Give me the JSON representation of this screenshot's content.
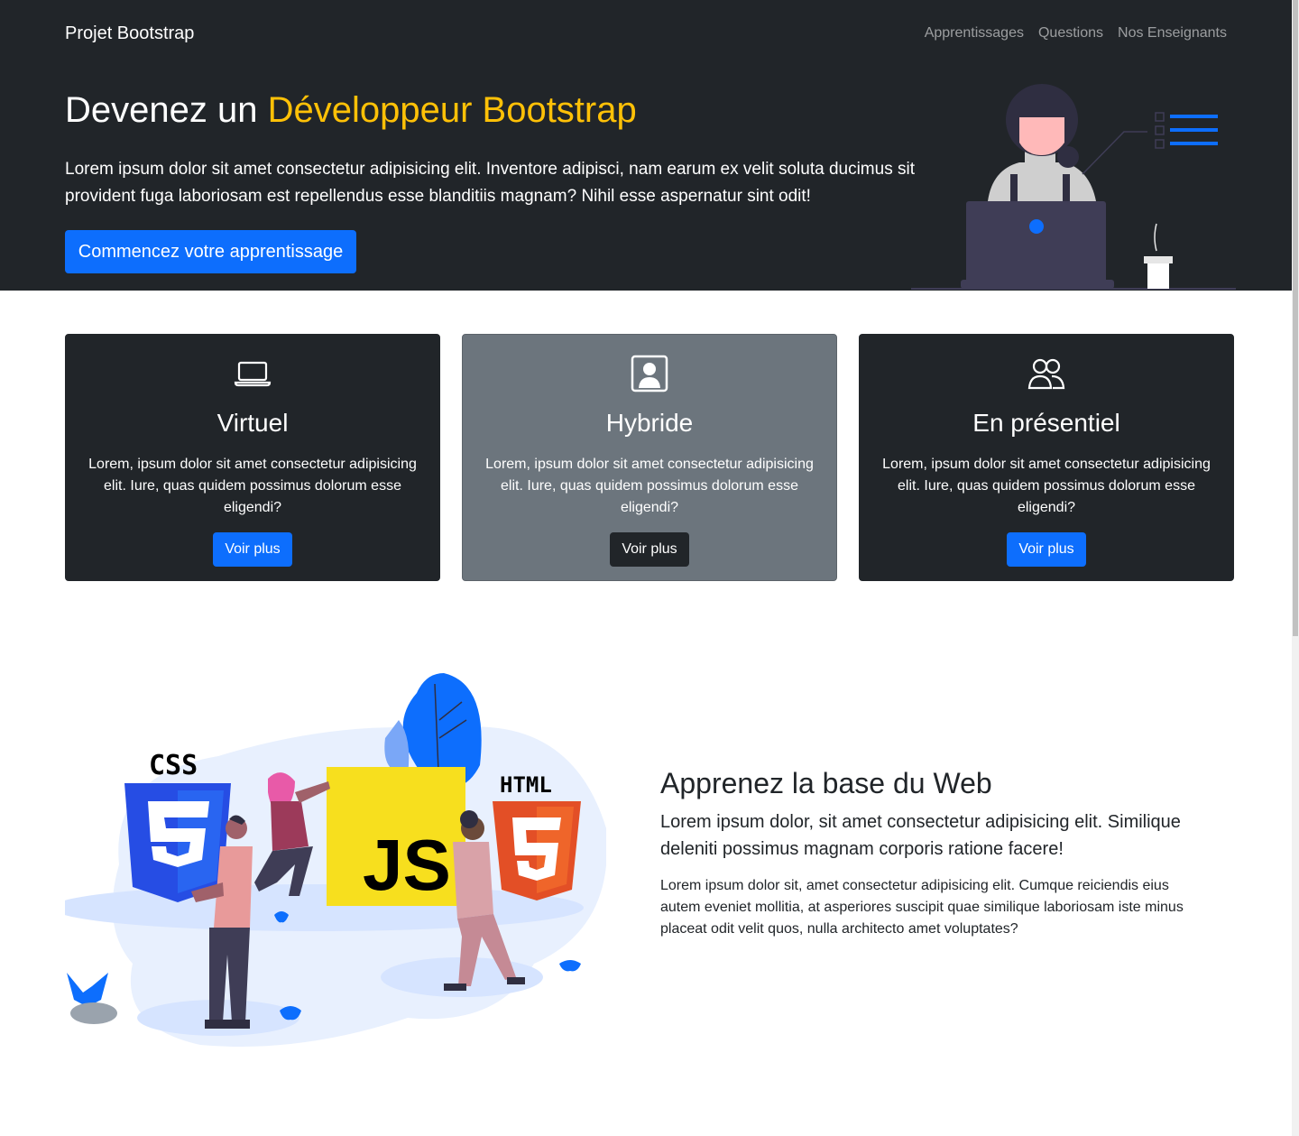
{
  "navbar": {
    "brand": "Projet Bootstrap",
    "links": [
      "Apprentissages",
      "Questions",
      "Nos Enseignants"
    ]
  },
  "hero": {
    "title_prefix": "Devenez un ",
    "title_accent": "Développeur Bootstrap",
    "lead": "Lorem ipsum dolor sit amet consectetur adipisicing elit. Inventore adipisci, nam earum ex velit soluta ducimus sit provident fuga laboriosam est repellendus esse blanditiis magnam? Nihil esse aspernatur sint odit!",
    "button": "Commencez votre apprentissage"
  },
  "cards": [
    {
      "icon": "laptop-icon",
      "title": "Virtuel",
      "text": "Lorem, ipsum dolor sit amet consectetur adipisicing elit. Iure, quas quidem possimus dolorum esse eligendi?",
      "button": "Voir plus"
    },
    {
      "icon": "person-badge-icon",
      "title": "Hybride",
      "text": "Lorem, ipsum dolor sit amet consectetur adipisicing elit. Iure, quas quidem possimus dolorum esse eligendi?",
      "button": "Voir plus"
    },
    {
      "icon": "people-icon",
      "title": "En présentiel",
      "text": "Lorem, ipsum dolor sit amet consectetur adipisicing elit. Iure, quas quidem possimus dolorum esse eligendi?",
      "button": "Voir plus"
    }
  ],
  "web_section": {
    "title": "Apprenez la base du Web",
    "lead": "Lorem ipsum dolor, sit amet consectetur adipisicing elit. Similique deleniti possimus magnam corporis ratione facere!",
    "text": "Lorem ipsum dolor sit, amet consectetur adipisicing elit. Cumque reiciendis eius autem eveniet mollitia, at asperiores suscipit quae similique laboriosam iste minus placeat odit velit quos, nulla architecto amet voluptates?",
    "logos": {
      "css": "CSS",
      "js": "JS",
      "html": "HTML"
    }
  },
  "colors": {
    "dark": "#212529",
    "accent": "#ffc107",
    "primary": "#0d6efd",
    "secondary": "#6c757d"
  }
}
